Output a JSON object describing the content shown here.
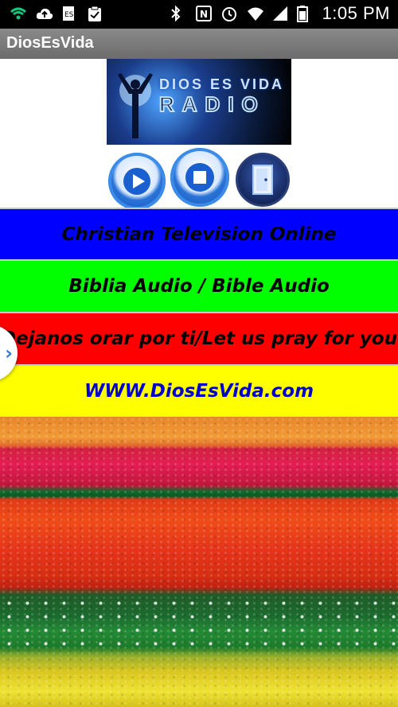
{
  "status_bar": {
    "time": "1:05 PM",
    "left_icons": [
      "wifi-signal-icon",
      "cloud-upload-icon",
      "sim-card-icon",
      "clipboard-check-icon"
    ],
    "right_icons": [
      "bluetooth-icon",
      "nfc-icon",
      "alarm-icon",
      "wifi-icon",
      "cell-signal-icon",
      "battery-icon"
    ]
  },
  "app_bar": {
    "title": "DiosEsVida"
  },
  "logo": {
    "line1": "DIOS ES VIDA",
    "line2": "RADIO"
  },
  "controls": {
    "play_icon": "play-icon",
    "stop_icon": "stop-icon",
    "exit_icon": "door-exit-icon"
  },
  "buttons": [
    {
      "label": "Christian Television Online",
      "bg": "#0000ff",
      "fg": "#000000"
    },
    {
      "label": "Biblia Audio / Bible Audio",
      "bg": "#00ff00",
      "fg": "#000000"
    },
    {
      "label": "Dejanos orar por ti/Let us pray for you",
      "bg": "#ff0000",
      "fg": "#000000"
    },
    {
      "label": "WWW.DiosEsVida.com",
      "bg": "#ffff00",
      "fg": "#0000cc"
    }
  ],
  "side_handle": {
    "glyph": "›"
  }
}
